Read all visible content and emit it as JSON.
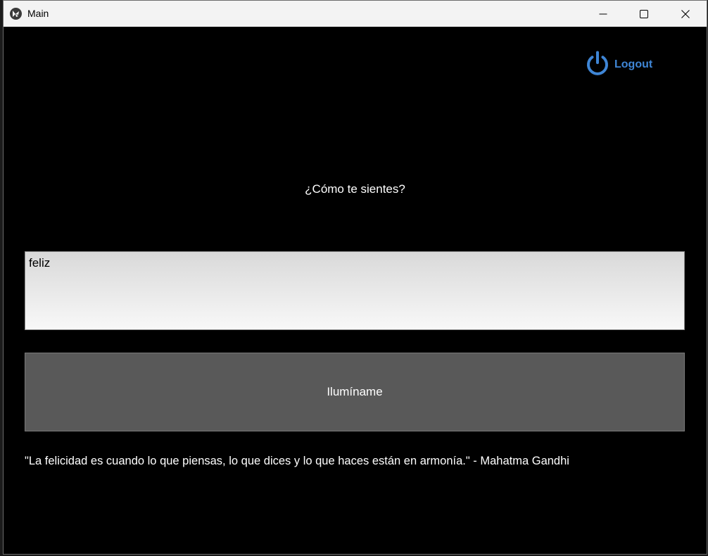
{
  "window": {
    "title": "Main",
    "app_icon": "kivy-logo-icon",
    "controls": [
      "minimize-icon",
      "maximize-icon",
      "close-icon"
    ]
  },
  "header": {
    "logout_label": "Logout",
    "logout_icon": "power-icon",
    "accent_color": "#3f86d6"
  },
  "main": {
    "prompt": "¿Cómo te sientes?",
    "input_value": "feliz",
    "button_label": "Ilumíname",
    "quote": "\"La felicidad es cuando lo que piensas, lo que dices y lo que haces están en armonía.\" - Mahatma Gandhi"
  }
}
